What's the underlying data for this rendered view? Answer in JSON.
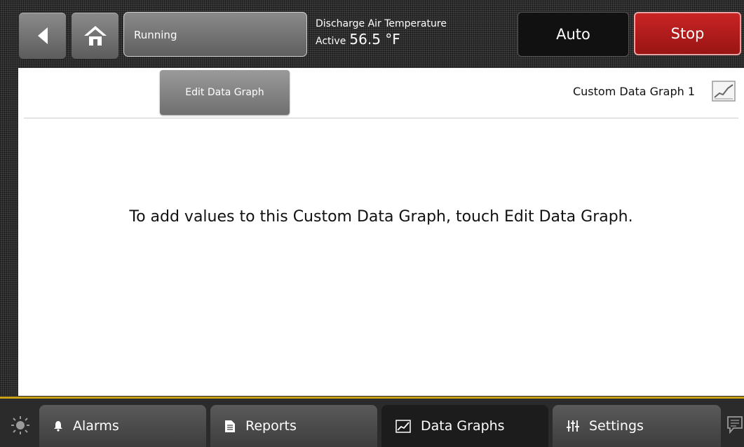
{
  "header": {
    "status": "Running",
    "discharge_label": "Discharge Air Temperature",
    "active_label": "Active",
    "active_value": "56.5 °F",
    "mode_label": "Auto",
    "stop_label": "Stop"
  },
  "panel": {
    "edit_button": "Edit Data Graph",
    "graph_title": "Custom Data Graph 1",
    "message": "To add values to this Custom Data Graph, touch Edit Data Graph."
  },
  "tabs": [
    {
      "label": "Alarms",
      "icon": "bell-icon"
    },
    {
      "label": "Reports",
      "icon": "document-icon"
    },
    {
      "label": "Data Graphs",
      "icon": "graph-icon"
    },
    {
      "label": "Settings",
      "icon": "sliders-icon"
    }
  ],
  "colors": {
    "stop": "#b81c1c",
    "accent_line": "#c9a21a",
    "panel": "#ffffff"
  }
}
